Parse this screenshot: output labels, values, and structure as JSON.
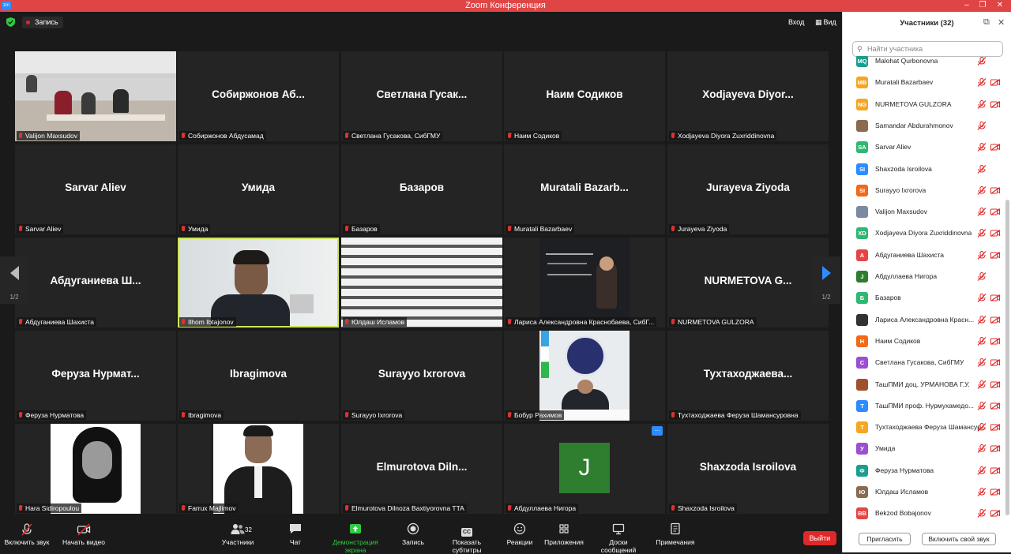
{
  "window": {
    "title": "Zoom Конференция",
    "logo": "zm"
  },
  "topbar": {
    "recording": "Запись",
    "enter": "Вход",
    "view": "Вид"
  },
  "gallery": {
    "tiles": [
      {
        "name": "",
        "label": "Valijon Maxsudov"
      },
      {
        "name": "Собиржонов  Аб...",
        "label": "Собиржонов Абдусамад"
      },
      {
        "name": "Светлана  Гусак...",
        "label": "Светлана Гусакова, СибГМУ"
      },
      {
        "name": "Наим Содиков",
        "label": "Наим Содиков"
      },
      {
        "name": "Xodjayeva  Diyor...",
        "label": "Xodjayeva Diyora Zuxriddinovna"
      },
      {
        "name": "Sarvar Aliev",
        "label": "Sarvar Aliev"
      },
      {
        "name": "Умида",
        "label": "Умида"
      },
      {
        "name": "Базаров",
        "label": "Базаров"
      },
      {
        "name": "Muratali  Bazarb...",
        "label": "Muratali Bazarbaev"
      },
      {
        "name": "Jurayeva  Ziyoda",
        "label": "Jurayeva Ziyoda"
      },
      {
        "name": "Абдуганиева  Ш...",
        "label": "Абдуганиева Шахиста"
      },
      {
        "name": "",
        "label": "Ilhom Ibtajonov"
      },
      {
        "name": "",
        "label": "Юлдаш Исламов"
      },
      {
        "name": "",
        "label": "Лариса Александровна Краснобаева, СибГ..."
      },
      {
        "name": "NURMETOVA  G...",
        "label": "NURMETOVA GULZORA"
      },
      {
        "name": "Феруза  Нурмат...",
        "label": "Феруза Нурматова"
      },
      {
        "name": "Ibragimova",
        "label": "Ibragimova"
      },
      {
        "name": "Surayyo  Ixrorova",
        "label": "Surayyo Ixrorova"
      },
      {
        "name": "",
        "label": "Бобур Рахимов"
      },
      {
        "name": "Тухтаходжаева...",
        "label": "Тухтаходжаева Феруза Шамансуровна"
      },
      {
        "name": "",
        "label": "Hara Sidiropoulou"
      },
      {
        "name": "",
        "label": "Farrux Majlimov"
      },
      {
        "name": "Elmurotova  Diln...",
        "label": "Elmurotova Dilnoza Baxtiyorovna TTA"
      },
      {
        "name": "",
        "label": "Абдуллаева Нигора",
        "avatar_letter": "J"
      },
      {
        "name": "Shaxzoda  Isroilova",
        "label": "Shaxzoda Isroilova"
      }
    ],
    "page_left": "1/2",
    "page_right": "1/2",
    "more_dots": "..."
  },
  "toolbar": {
    "mute": "Включить звук",
    "video": "Начать видео",
    "participants": "Участники",
    "participants_count": "32",
    "chat": "Чат",
    "share": "Демонстрация экрана",
    "record": "Запись",
    "captions": "Показать субтитры",
    "captions_badge": "CC",
    "reactions": "Реакции",
    "apps": "Приложения",
    "whiteboards": "Доски сообщений",
    "notes": "Примечания",
    "leave": "Выйти"
  },
  "panel": {
    "title": "Участники (32)",
    "search_placeholder": "Найти участника",
    "participants": [
      {
        "initials": "MQ",
        "name": "Malohat Qurbonovna",
        "color": "#1a9e8f",
        "cam": false
      },
      {
        "initials": "MB",
        "name": "Muratali Bazarbaev",
        "color": "#f5a623",
        "cam": true
      },
      {
        "initials": "NG",
        "name": "NURMETOVA GULZORA",
        "color": "#f5a623",
        "cam": true
      },
      {
        "initials": "",
        "name": "Samandar Abdurahmonov",
        "color": "#8a6a50",
        "cam": false
      },
      {
        "initials": "SA",
        "name": "Sarvar Aliev",
        "color": "#2eb872",
        "cam": true
      },
      {
        "initials": "SI",
        "name": "Shaxzoda Isroilova",
        "color": "#2d8cff",
        "cam": false
      },
      {
        "initials": "SI",
        "name": "Surayyo Ixrorova",
        "color": "#f06a1a",
        "cam": true
      },
      {
        "initials": "",
        "name": "Valijon Maxsudov",
        "color": "#7a8aa0",
        "cam": true
      },
      {
        "initials": "XD",
        "name": "Xodjayeva Diyora Zuxriddinovna",
        "color": "#2eb872",
        "cam": true
      },
      {
        "initials": "А",
        "name": "Абдуганиева Шахиста",
        "color": "#e64545",
        "cam": true
      },
      {
        "initials": "J",
        "name": "Абдуллаева Нигора",
        "color": "#2f7d2f",
        "cam": false
      },
      {
        "initials": "Б",
        "name": "Базаров",
        "color": "#2eb872",
        "cam": true
      },
      {
        "initials": "",
        "name": "Лариса Александровна Красн...",
        "color": "#333333",
        "cam": true
      },
      {
        "initials": "Н",
        "name": "Наим Содиков",
        "color": "#f06a1a",
        "cam": true
      },
      {
        "initials": "С",
        "name": "Светлана Гусакова, СибГМУ",
        "color": "#9b4fd1",
        "cam": true
      },
      {
        "initials": "",
        "name": "ТашПМИ доц. УРМАНОВА Г.У.",
        "color": "#a0522d",
        "cam": true
      },
      {
        "initials": "Т",
        "name": "ТашПМИ проф. Нурмухамедо...",
        "color": "#2d8cff",
        "cam": true
      },
      {
        "initials": "Т",
        "name": "Тухтаходжаева Феруза Шамансур...",
        "color": "#f5a623",
        "cam": true
      },
      {
        "initials": "У",
        "name": "Умида",
        "color": "#9b4fd1",
        "cam": true
      },
      {
        "initials": "Ф",
        "name": "Феруза Нурматова",
        "color": "#1a9e8f",
        "cam": true
      },
      {
        "initials": "Ю",
        "name": "Юлдаш Исламов",
        "color": "#8a6a50",
        "cam": true
      },
      {
        "initials": "BB",
        "name": "Bekzod Bobajonov",
        "color": "#e64545",
        "cam": true
      }
    ],
    "invite": "Пригласить",
    "unmute_me": "Включить свой звук"
  }
}
